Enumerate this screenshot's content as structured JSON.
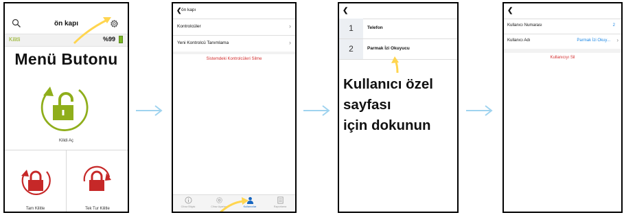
{
  "screen1": {
    "title": "ön kapı",
    "lock_state": "Kilitli",
    "battery": "%99",
    "menu_button_label": "Menü Butonu",
    "unlock_label": "Kilidi Aç",
    "full_lock_label": "Tam Kilitle",
    "single_turn_lock_label": "Tek Tur Kilitle",
    "icons": [
      "search-icon",
      "gear-icon",
      "unlock-icon",
      "lock-icon"
    ]
  },
  "screen2": {
    "back_label": "ön kapı",
    "rows": [
      {
        "label": "Kontrolcüler"
      },
      {
        "label": "Yeni Kontrolcü Tanımlama"
      }
    ],
    "delete_label": "Sistemdeki Kontrolcüleri Silme",
    "tabs": [
      {
        "label": "Cihaz Bilgisi",
        "icon": "info-icon"
      },
      {
        "label": "Cihaz Ayarları",
        "icon": "gear-icon"
      },
      {
        "label": "Kullanıcılar",
        "icon": "user-icon"
      },
      {
        "label": "Raporlama",
        "icon": "report-icon"
      }
    ]
  },
  "screen3": {
    "users": [
      {
        "number": "1",
        "name": "Telefon"
      },
      {
        "number": "2",
        "name": "Parmak İzi Okuyucu"
      }
    ],
    "instruction_line1": "Kullanıcı özel",
    "instruction_line2": "sayfası",
    "instruction_line3": "için dokunun"
  },
  "screen4": {
    "user_number_label": "Kullanıcı Numarası",
    "user_number_value": "2",
    "user_name_label": "Kullanıcı Adı",
    "user_name_value": "Parmak İzi Okuy...",
    "delete_label": "Kullanıcıyı Sil"
  },
  "colors": {
    "green": "#8fae1b",
    "red": "#c62828",
    "blue": "#1e88e5",
    "yellow": "#ffd54f",
    "arrow_blue": "#9fd3ef"
  }
}
